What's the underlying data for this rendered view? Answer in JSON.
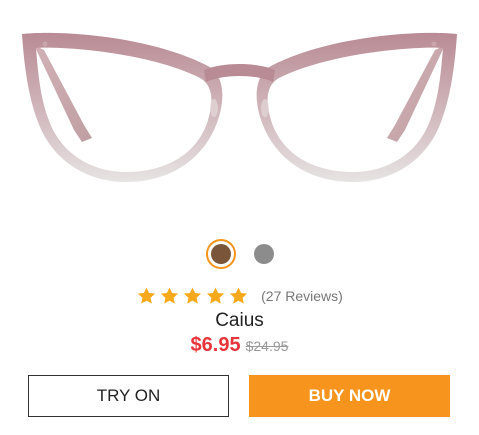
{
  "product": {
    "name": "Caius",
    "price": "$6.95",
    "original_price": "$24.95",
    "rating": 5,
    "reviews_text": "(27 Reviews)"
  },
  "swatches": [
    {
      "color": "#7b5539",
      "selected": true
    },
    {
      "color": "#8c8c8c",
      "selected": false
    }
  ],
  "buttons": {
    "try_on": "TRY ON",
    "buy_now": "BUY NOW"
  },
  "colors": {
    "accent": "#f7941d",
    "price": "#e8343a",
    "star": "#f7a81b",
    "frame_top": "#b98b94"
  }
}
